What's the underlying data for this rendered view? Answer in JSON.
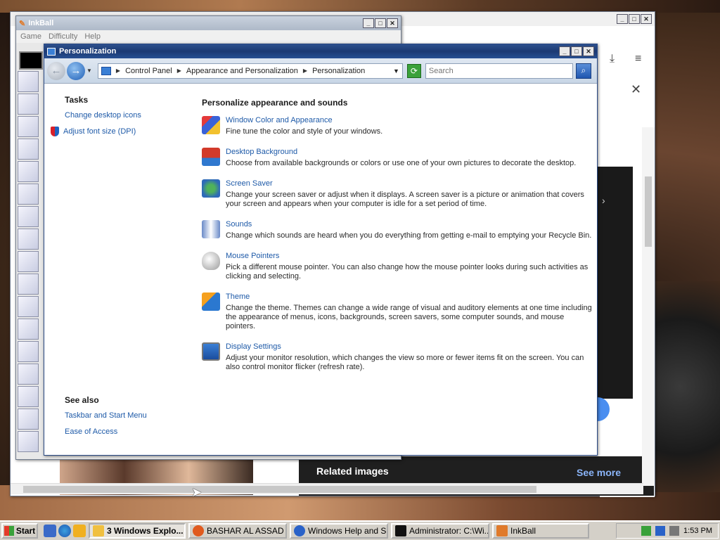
{
  "inkball": {
    "title": "InkBall",
    "menu": [
      "Game",
      "Difficulty",
      "Help"
    ]
  },
  "browser": {
    "related_images": "Related images",
    "see_more": "See more"
  },
  "personalization": {
    "title": "Personalization",
    "breadcrumb": [
      "Control Panel",
      "Appearance and Personalization",
      "Personalization"
    ],
    "search_placeholder": "Search",
    "tasks_title": "Tasks",
    "tasks": [
      "Change desktop icons",
      "Adjust font size (DPI)"
    ],
    "see_also_title": "See also",
    "see_also": [
      "Taskbar and Start Menu",
      "Ease of Access"
    ],
    "main_title": "Personalize appearance and sounds",
    "items": [
      {
        "title": "Window Color and Appearance",
        "desc": "Fine tune the color and style of your windows.",
        "icon": "window-color-icon"
      },
      {
        "title": "Desktop Background",
        "desc": "Choose from available backgrounds or colors or use one of your own pictures to decorate the desktop.",
        "icon": "desktop-background-icon"
      },
      {
        "title": "Screen Saver",
        "desc": "Change your screen saver or adjust when it displays. A screen saver is a picture or animation that covers your screen and appears when your computer is idle for a set period of time.",
        "icon": "screen-saver-icon"
      },
      {
        "title": "Sounds",
        "desc": "Change which sounds are heard when you do everything from getting e-mail to emptying your Recycle Bin.",
        "icon": "sounds-icon"
      },
      {
        "title": "Mouse Pointers",
        "desc": "Pick a different mouse pointer. You can also change how the mouse pointer looks during such activities as clicking and selecting.",
        "icon": "mouse-pointer-icon"
      },
      {
        "title": "Theme",
        "desc": "Change the theme. Themes can change a wide range of visual and auditory elements at one time including the appearance of menus, icons, backgrounds, screen savers, some computer sounds, and mouse pointers.",
        "icon": "theme-icon"
      },
      {
        "title": "Display Settings",
        "desc": "Adjust your monitor resolution, which changes the view so more or fewer items fit on the screen. You can also control monitor flicker (refresh rate).",
        "icon": "display-settings-icon"
      }
    ]
  },
  "taskbar": {
    "start": "Start",
    "buttons": [
      {
        "label": "3 Windows Explo...",
        "icon": "folder-icon",
        "color": "#f0c040"
      },
      {
        "label": "BASHAR AL ASSAD - ...",
        "icon": "firefox-icon",
        "color": "#e05a1e"
      },
      {
        "label": "Windows Help and S...",
        "icon": "help-icon",
        "color": "#2a62c8"
      },
      {
        "label": "Administrator: C:\\Wi...",
        "icon": "cmd-icon",
        "color": "#111111"
      },
      {
        "label": "InkBall",
        "icon": "inkball-icon",
        "color": "#e07a2a"
      }
    ],
    "clock": "1:53 PM"
  }
}
